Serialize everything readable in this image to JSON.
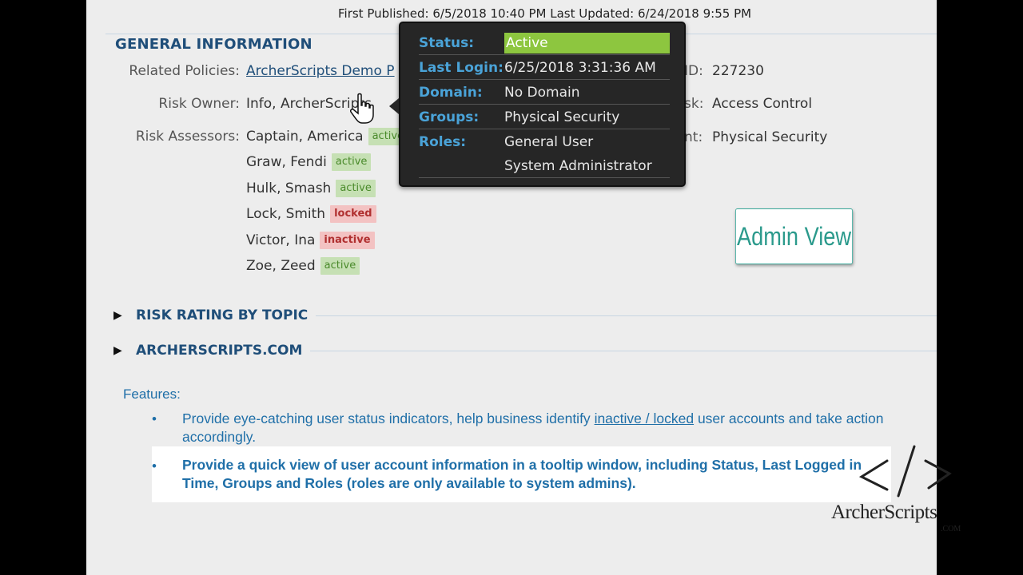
{
  "header": {
    "published_line": "First Published: 6/5/2018 10:40 PM Last Updated: 6/24/2018 9:55 PM"
  },
  "general_info": {
    "title": "GENERAL INFORMATION",
    "related_policies_label": "Related Policies:",
    "related_policies_value": "ArcherScripts Demo P",
    "risk_owner_label": "Risk Owner:",
    "risk_owner_value": "Info, ArcherScripts",
    "risk_assessors_label": "Risk Assessors:",
    "assessors": [
      {
        "name": "Captain, America",
        "status": "active"
      },
      {
        "name": "Graw, Fendi",
        "status": "active"
      },
      {
        "name": "Hulk, Smash",
        "status": "active"
      },
      {
        "name": "Lock, Smith",
        "status": "locked"
      },
      {
        "name": "Victor, Ina",
        "status": "inactive"
      },
      {
        "name": "Zoe, Zeed",
        "status": "active"
      }
    ],
    "id_label": "ID:",
    "id_value": "227230",
    "risk_label": "sk:",
    "risk_value": "Access Control",
    "nt_label": "nt:",
    "nt_value": "Physical Security"
  },
  "tooltip": {
    "status_label": "Status:",
    "status_value": "Active",
    "last_login_label": "Last Login:",
    "last_login_value": "6/25/2018 3:31:36 AM",
    "domain_label": "Domain:",
    "domain_value": "No Domain",
    "groups_label": "Groups:",
    "groups_value": "Physical Security",
    "roles_label": "Roles:",
    "roles": [
      "General User",
      "System Administrator"
    ]
  },
  "sections": [
    {
      "title": "RISK RATING BY TOPIC"
    },
    {
      "title": "ARCHERSCRIPTS.COM"
    }
  ],
  "admin_view_label": "Admin View",
  "features": {
    "label": "Features:",
    "item1_part1": "Provide eye-catching user status indicators, help business identify ",
    "item1_link": "inactive / locked",
    "item1_part2": " user accounts and take action accordingly.",
    "item2": "Provide a quick view of user account information in a tooltip window, including Status, Last Logged in Time, Groups and Roles (roles are only available to system admins)."
  },
  "logo": {
    "text": "ArcherScripts",
    "com": ".COM"
  },
  "colors": {
    "section_blue": "#1f4e79",
    "feature_blue": "#1f6fa8",
    "active_bg": "#c6e0b4",
    "locked_bg": "#f3c2c2",
    "tooltip_bg": "#262626",
    "tooltip_key": "#4aa3d8",
    "status_green": "#8dc63f",
    "admin_teal": "#2b9a8c"
  }
}
